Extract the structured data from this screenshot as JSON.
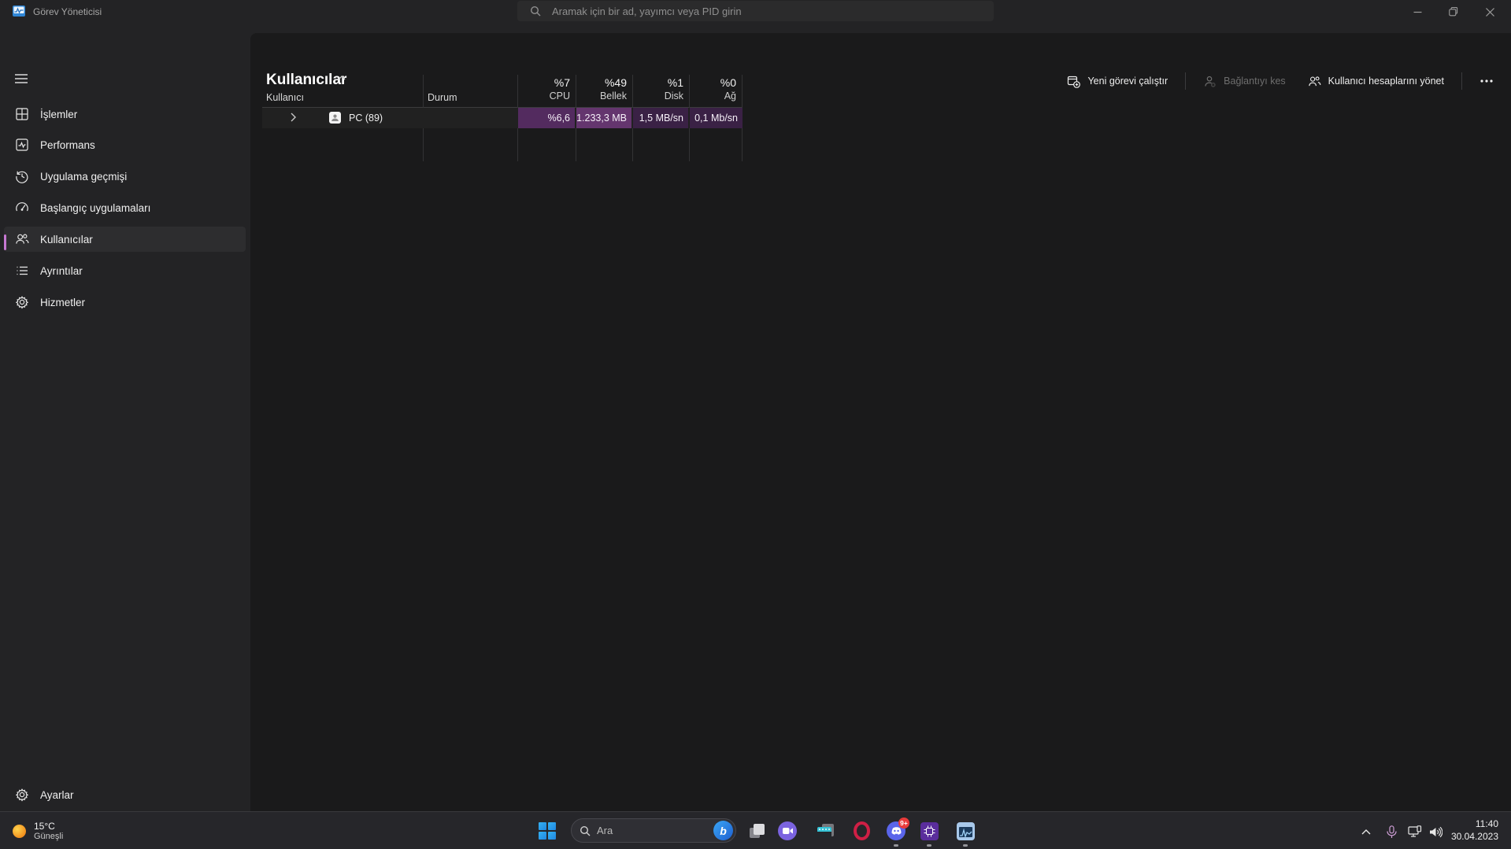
{
  "titlebar": {
    "app_title": "Görev Yöneticisi",
    "search_placeholder": "Aramak için bir ad, yayımcı veya PID girin"
  },
  "sidebar": {
    "items": [
      {
        "label": "İşlemler",
        "icon": "processes-grid-icon"
      },
      {
        "label": "Performans",
        "icon": "performance-pulse-icon"
      },
      {
        "label": "Uygulama geçmişi",
        "icon": "history-clock-icon"
      },
      {
        "label": "Başlangıç uygulamaları",
        "icon": "startup-gauge-icon"
      },
      {
        "label": "Kullanıcılar",
        "icon": "users-icon",
        "selected": true
      },
      {
        "label": "Ayrıntılar",
        "icon": "details-list-icon"
      },
      {
        "label": "Hizmetler",
        "icon": "services-gear-icon"
      }
    ],
    "settings_label": "Ayarlar"
  },
  "page": {
    "title": "Kullanıcılar"
  },
  "toolbar": {
    "run_new_task": "Yeni görevi çalıştır",
    "disconnect": "Bağlantıyı kes",
    "manage_accounts": "Kullanıcı hesaplarını yönet"
  },
  "table": {
    "headers": [
      {
        "label": "Kullanıcı",
        "sorted": "asc"
      },
      {
        "label": "Durum"
      },
      {
        "total": "%7",
        "label": "CPU"
      },
      {
        "total": "%49",
        "label": "Bellek"
      },
      {
        "total": "%1",
        "label": "Disk"
      },
      {
        "total": "%0",
        "label": "Ağ"
      }
    ],
    "rows": [
      {
        "user": "PC (89)",
        "status": "",
        "cpu": "%6,6",
        "memory": "1.233,3 MB",
        "disk": "1,5 MB/sn",
        "network": "0,1 Mb/sn"
      }
    ]
  },
  "taskbar": {
    "weather": {
      "temperature": "15°C",
      "condition": "Güneşli"
    },
    "search_label": "Ara",
    "discord_badge": "9+",
    "clock": {
      "time": "11:40",
      "date": "30.04.2023"
    }
  },
  "colors": {
    "accent": "#c678d2",
    "chrome_bg": "#232325",
    "card_bg": "#1a1a1b",
    "taskbar_bg": "#26262a",
    "heat_cpu": "#532b5f",
    "heat_memory": "#64356e",
    "heat_disk": "#3a2145",
    "heat_network": "#3a2145"
  }
}
